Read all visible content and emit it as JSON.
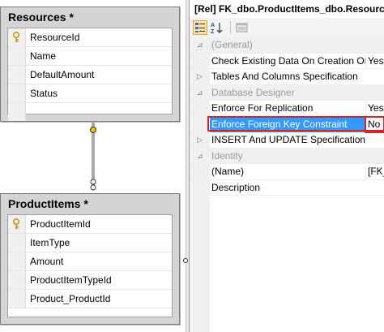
{
  "diagram": {
    "tables": [
      {
        "title": "Resources *",
        "columns": [
          {
            "name": "ResourceId",
            "key": true
          },
          {
            "name": "Name",
            "key": false
          },
          {
            "name": "DefaultAmount",
            "key": false
          },
          {
            "name": "Status",
            "key": false
          }
        ]
      },
      {
        "title": "ProductItems *",
        "columns": [
          {
            "name": "ProductItemId",
            "key": true
          },
          {
            "name": "ItemType",
            "key": false
          },
          {
            "name": "Amount",
            "key": false
          },
          {
            "name": "ProductItemTypeId",
            "key": false
          },
          {
            "name": "Product_ProductId",
            "key": false
          }
        ]
      }
    ]
  },
  "properties": {
    "header": "[Rel] FK_dbo.ProductItems_dbo.Resources_",
    "rows": [
      {
        "type": "category",
        "name": "(General)",
        "value": ""
      },
      {
        "type": "prop",
        "name": "Check Existing Data On Creation Or",
        "value": "Yes"
      },
      {
        "type": "expandable",
        "name": "Tables And Columns Specification",
        "value": ""
      },
      {
        "type": "category",
        "name": "Database Designer",
        "value": ""
      },
      {
        "type": "prop",
        "name": "Enforce For Replication",
        "value": "Yes"
      },
      {
        "type": "selected",
        "name": "Enforce Foreign Key Constraint",
        "value": "No"
      },
      {
        "type": "expandable",
        "name": "INSERT And UPDATE Specification",
        "value": ""
      },
      {
        "type": "category",
        "name": "Identity",
        "value": ""
      },
      {
        "type": "prop",
        "name": "(Name)",
        "value": "[FK_"
      },
      {
        "type": "prop",
        "name": "Description",
        "value": ""
      }
    ]
  },
  "icons": {
    "key": "key-icon",
    "categorized": "categorized-icon",
    "alphabetical": "alphabetical-icon",
    "property-pages": "property-pages-icon"
  },
  "colors": {
    "selection": "#3399ff",
    "highlight_border": "#d8232a",
    "key_gold": "#d9a81f"
  }
}
